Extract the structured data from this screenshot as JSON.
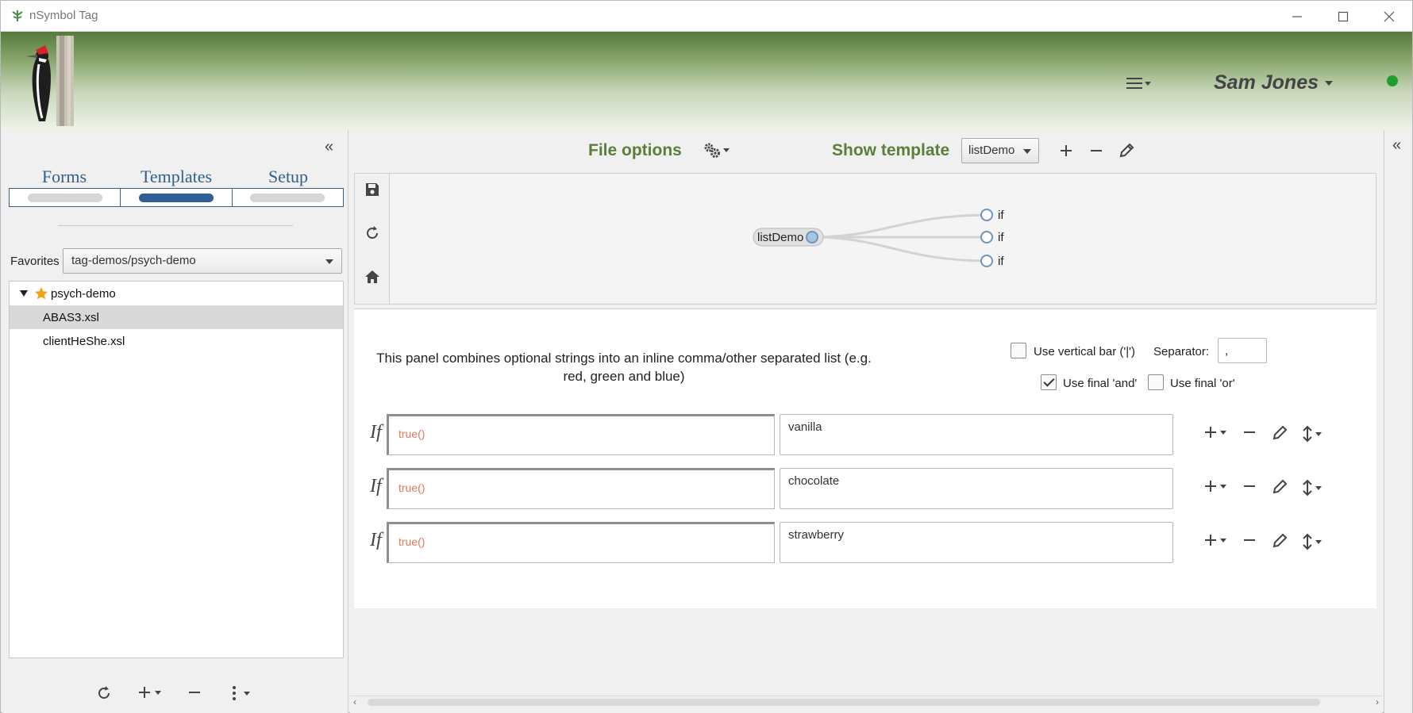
{
  "window": {
    "title": "nSymbol Tag",
    "controls": [
      "minimize-icon",
      "maximize-icon",
      "close-icon"
    ]
  },
  "header": {
    "user_name": "Sam Jones",
    "status_color": "#1d9e2b",
    "menu_icon": "hamburger-menu-icon"
  },
  "sidebar": {
    "tabs": [
      {
        "label": "Forms",
        "active": false
      },
      {
        "label": "Templates",
        "active": true
      },
      {
        "label": "Setup",
        "active": false
      }
    ],
    "favorites_label": "Favorites",
    "favorites_value": "tag-demos/psych-demo",
    "tree": {
      "root": "psych-demo",
      "items": [
        "ABAS3.xsl",
        "clientHeShe.xsl"
      ],
      "selected": "ABAS3.xsl"
    }
  },
  "toolbar": {
    "file_options": "File options",
    "show_template": "Show template",
    "template_value": "listDemo"
  },
  "template_tree": {
    "root": "listDemo",
    "children": [
      "if",
      "if",
      "if"
    ]
  },
  "panel": {
    "description": "This panel combines optional strings into an inline comma/other separated list (e.g. red, green and blue)",
    "use_vertical_bar": {
      "label": "Use vertical bar ('|')",
      "checked": false
    },
    "separator_label": "Separator:",
    "separator_value": ",",
    "use_final_and": {
      "label": "Use final 'and'",
      "checked": true
    },
    "use_final_or": {
      "label": "Use final 'or'",
      "checked": false
    },
    "if_label": "If",
    "rows": [
      {
        "condition": "true()",
        "text": "vanilla"
      },
      {
        "condition": "true()",
        "text": "chocolate"
      },
      {
        "condition": "true()",
        "text": "strawberry"
      }
    ]
  },
  "colors": {
    "accent_green": "#5b7f3b",
    "tab_blue": "#335f8a",
    "condition_text": "#e0785a"
  }
}
